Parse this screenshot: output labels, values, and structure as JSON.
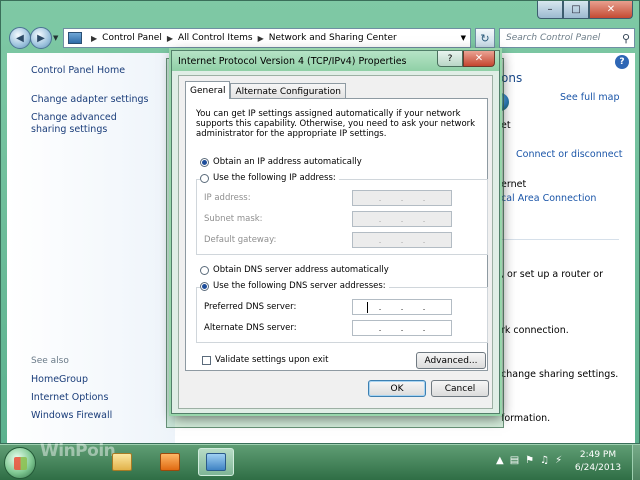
{
  "explorer": {
    "breadcrumb": [
      "Control Panel",
      "All Control Items",
      "Network and Sharing Center"
    ],
    "search_placeholder": "Search Control Panel",
    "left_pane": {
      "home": "Control Panel Home",
      "adapter": "Change adapter settings",
      "advanced": "Change advanced sharing settings",
      "see_also": "See also",
      "homegroup": "HomeGroup",
      "internet_options": "Internet Options",
      "firewall": "Windows Firewall"
    },
    "right_pane": {
      "title_fragment": "ons",
      "see_full_map": "See full map",
      "net_fragment": "et",
      "connect_disconnect": "Connect or disconnect",
      "internet_fragment": "ernet",
      "local_area": "cal Area Connection",
      "router_fragment": ", or set up a router or",
      "connection_fragment": "rk connection.",
      "sharing_fragment": "change sharing settings.",
      "info_fragment": "formation."
    }
  },
  "dialog": {
    "title": "Internet Protocol Version 4 (TCP/IPv4) Properties",
    "tabs": [
      {
        "label": "General",
        "active": true
      },
      {
        "label": "Alternate Configuration",
        "active": false
      }
    ],
    "intro": "You can get IP settings assigned automatically if your network supports this capability. Otherwise, you need to ask your network administrator for the appropriate IP settings.",
    "ip_auto": {
      "label": "Obtain an IP address automatically",
      "selected": true
    },
    "ip_manual": {
      "label": "Use the following IP address:",
      "selected": false
    },
    "ip_fields": {
      "ip_address": "IP address:",
      "subnet_mask": "Subnet mask:",
      "default_gateway": "Default gateway:"
    },
    "dns_auto": {
      "label": "Obtain DNS server address automatically",
      "selected": false
    },
    "dns_manual": {
      "label": "Use the following DNS server addresses:",
      "selected": true
    },
    "dns_fields": {
      "preferred": "Preferred DNS server:",
      "alternate": "Alternate DNS server:"
    },
    "validate": {
      "label": "Validate settings upon exit",
      "checked": false
    },
    "advanced_button": "Advanced...",
    "ok_button": "OK",
    "cancel_button": "Cancel"
  },
  "taskbar": {
    "watermark": "WinPoin",
    "time": "2:49 PM",
    "date": "6/24/2013"
  },
  "colors": {
    "link": "#1a3d7a",
    "dialog_frame": "#98d6ab",
    "taskbar": "#2f6e45"
  }
}
